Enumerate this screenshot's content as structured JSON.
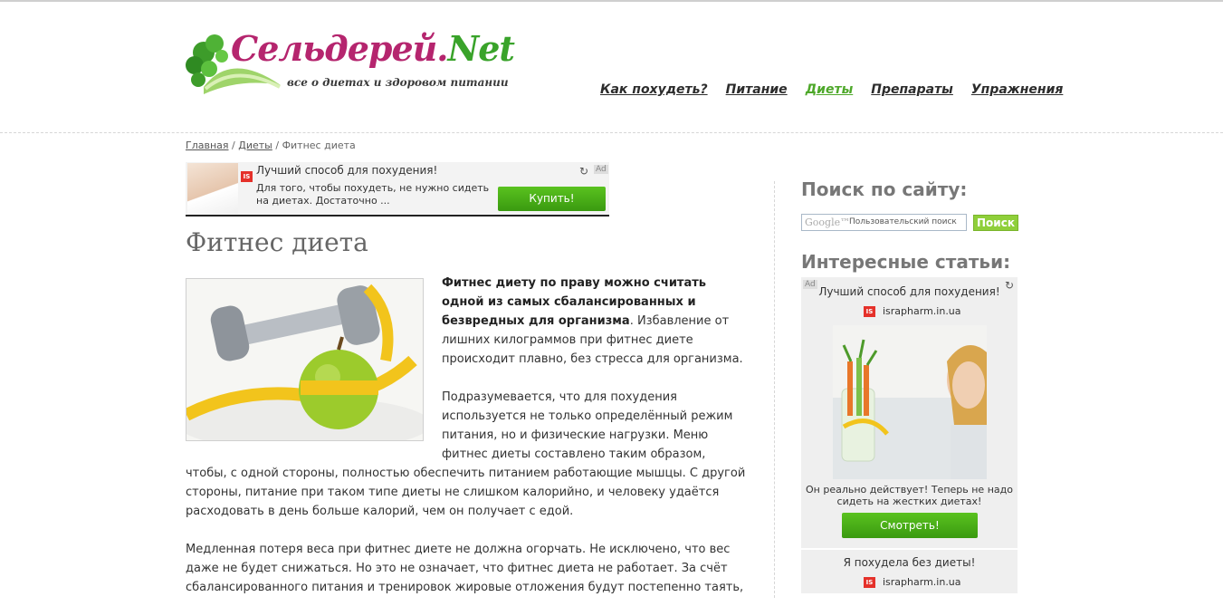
{
  "header": {
    "logo_title": "Сельдерей.",
    "logo_title_accent": "Net",
    "logo_tagline": "все о диетах и здоровом питании",
    "nav": [
      {
        "label": "Как похудеть?"
      },
      {
        "label": "Питание"
      },
      {
        "label": "Диеты",
        "active": true
      },
      {
        "label": "Препараты"
      },
      {
        "label": "Упражнения"
      }
    ]
  },
  "breadcrumb": {
    "home": "Главная",
    "sep1": "/",
    "section": "Диеты",
    "sep2": "/",
    "current": "Фитнес диета"
  },
  "ad_top": {
    "badge": "IS",
    "headline": "Лучший способ для похудения!",
    "body": "Для того, чтобы похудеть, не нужно сидеть на диетах. Достаточно ...",
    "button": "Купить!",
    "ad_tag": "Ad",
    "refresh_icon": "↻"
  },
  "article": {
    "title": "Фитнес диета",
    "p1_strong": "Фитнес диету по праву можно считать одной из самых сбалансированных и безвредных для организма",
    "p1_rest": ". Избавление от лишних килограммов при фитнес диете происходит плавно, без стресса для организма.",
    "p2": "Подразумевается, что для похудения используется не только определённый режим питания, но и физические нагрузки. Меню фитнес диеты составлено таким образом, чтобы, с одной стороны, полностью обеспечить питанием работающие мышцы. С другой стороны, питание при таком типе диеты не слишком калорийно, и человеку удаётся расходовать в день больше калорий, чем он получает с едой.",
    "p3": "Медленная потеря веса при фитнес диете не должна огорчать. Не исключено, что вес даже не будет снижаться. Но это не означает, что фитнес диета не работает. За счёт сбалансированного питания и тренировок жировые отложения будут постепенно таять,"
  },
  "sidebar": {
    "search_heading": "Поиск по сайту:",
    "search_placeholder": "Пользовательский поиск",
    "search_brand": "Google™",
    "search_button": "Поиск",
    "articles_heading": "Интересные статьи:",
    "ad": {
      "ad_tag": "Ad",
      "refresh_icon": "↻",
      "headline": "Лучший способ для похудения!",
      "badge": "IS",
      "domain": "israpharm.in.ua",
      "text": "Он реально действует! Теперь не надо сидеть на жестких диетах!",
      "button": "Смотреть!",
      "headline2": "Я похудела без диеты!",
      "domain2": "israpharm.in.ua"
    }
  },
  "colors": {
    "brand_magenta": "#b5256e",
    "brand_green": "#39a32a",
    "nav_active": "#4ea82a",
    "button_green": "#4bb11a"
  }
}
